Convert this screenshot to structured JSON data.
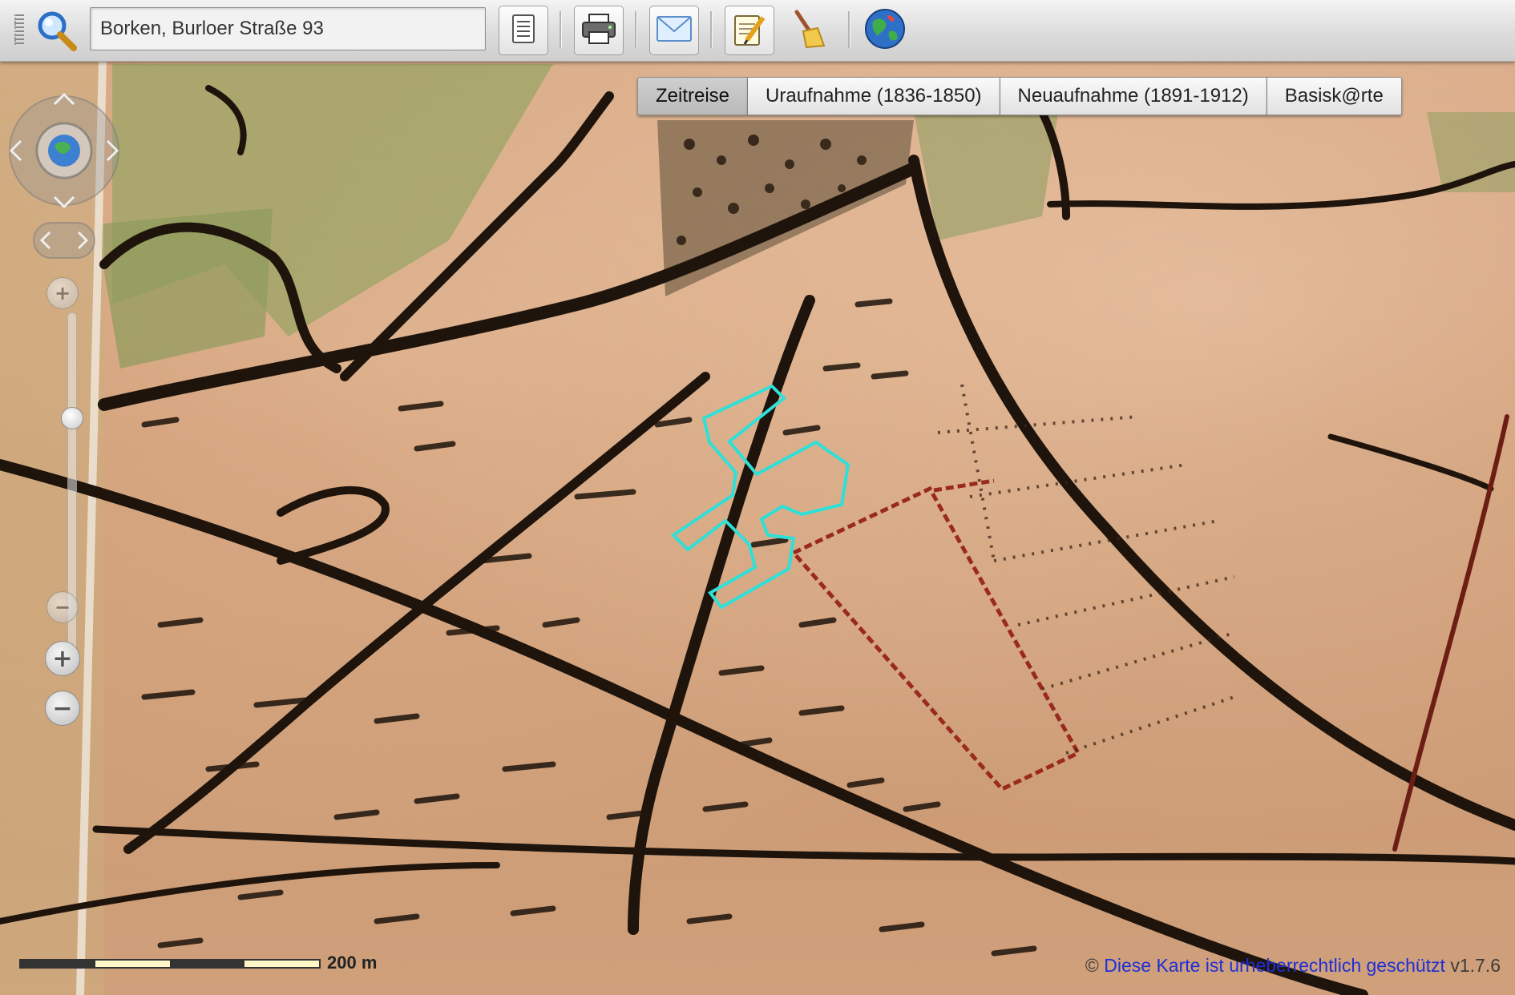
{
  "toolbar": {
    "search": {
      "value": "Borken, Burloer Straße 93",
      "icon": "search-icon"
    },
    "buttons": [
      {
        "name": "legend-button",
        "icon": "document-icon"
      },
      {
        "name": "print-button",
        "icon": "printer-icon"
      },
      {
        "name": "email-button",
        "icon": "envelope-icon"
      },
      {
        "name": "edit-button",
        "icon": "notepad-pencil-icon"
      },
      {
        "name": "clear-button",
        "icon": "broom-icon"
      },
      {
        "name": "globe-button",
        "icon": "globe-icon"
      }
    ]
  },
  "tabs": [
    {
      "label": "Zeitreise",
      "active": true
    },
    {
      "label": "Uraufnahme (1836-1850)",
      "active": false
    },
    {
      "label": "Neuaufnahme (1891-1912)",
      "active": false
    },
    {
      "label": "Basisk@rte",
      "active": false
    }
  ],
  "navigation": {
    "zoom_in_symbol": "+",
    "zoom_out_symbol": "−"
  },
  "map": {
    "scale_label": "200 m",
    "copyright_symbol": "©",
    "copyright_text": "Diese Karte ist urheberrechtlich geschützt",
    "version": "v1.7.6",
    "colors": {
      "parcel_outline": "#2ee0d8",
      "map_lines": "#1e140c",
      "red_boundary": "#9a2a1e"
    }
  }
}
